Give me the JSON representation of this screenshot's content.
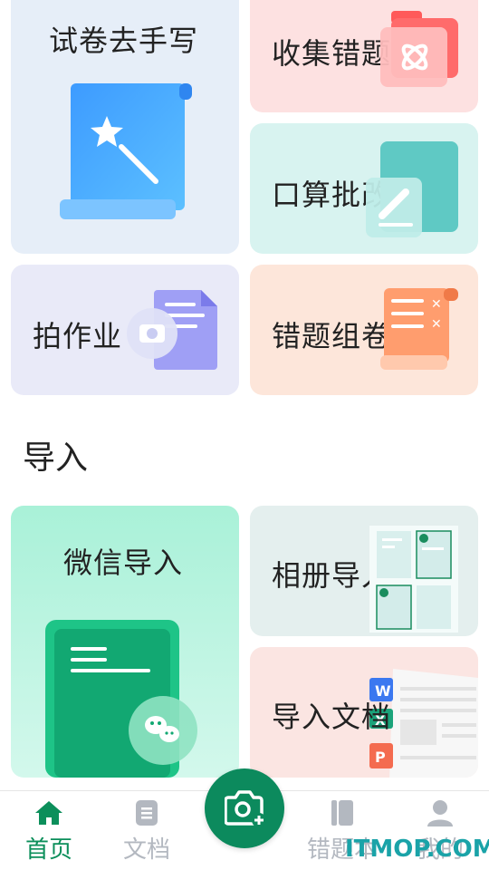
{
  "cards": {
    "handwrite": {
      "label": "试卷去手写",
      "icon": "magic-wand-scroll-icon"
    },
    "collect": {
      "label": "收集错题",
      "icon": "atom-folder-icon"
    },
    "mental": {
      "label": "口算批改",
      "icon": "pencil-board-icon"
    },
    "photo": {
      "label": "拍作业",
      "icon": "camera-document-icon"
    },
    "compose": {
      "label": "错题组卷",
      "icon": "checklist-scroll-icon"
    }
  },
  "import_section": {
    "title": "导入",
    "wechat": {
      "label": "微信导入",
      "icon": "wechat-document-icon"
    },
    "album": {
      "label": "相册导入",
      "icon": "photo-grid-icon"
    },
    "doc": {
      "label": "导入文档",
      "icon": "word-excel-ppt-icon",
      "file_badges": [
        "W",
        "X",
        "P"
      ]
    }
  },
  "bottom_nav": {
    "items": [
      {
        "label": "首页",
        "icon": "home-icon",
        "active": true
      },
      {
        "label": "文档",
        "icon": "document-icon",
        "active": false
      },
      {
        "label": "错题本",
        "icon": "notebook-icon",
        "active": false
      },
      {
        "label": "我的",
        "icon": "user-icon",
        "active": false
      }
    ],
    "center_button_icon": "camera-plus-icon"
  },
  "watermark": "ITMOP.COM",
  "colors": {
    "accent": "#0c8f5b",
    "nav_inactive": "#b3b8c0",
    "watermark": "#1aa3a8"
  }
}
